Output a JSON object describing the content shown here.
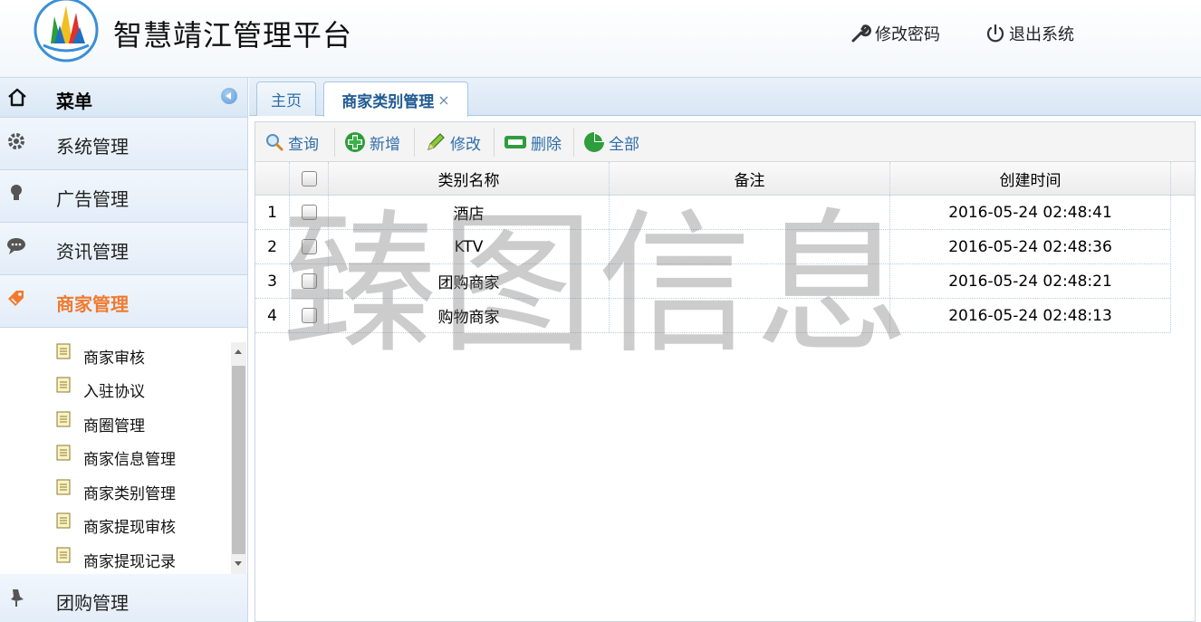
{
  "header": {
    "app_title": "智慧靖江管理平台",
    "change_password": "修改密码",
    "logout": "退出系统"
  },
  "sidebar": {
    "menu_title": "菜单",
    "groups": [
      {
        "label": "系统管理",
        "icon": "gear-icon"
      },
      {
        "label": "广告管理",
        "icon": "lightbulb-icon"
      },
      {
        "label": "资讯管理",
        "icon": "chat-bubble-icon"
      },
      {
        "label": "商家管理",
        "icon": "tag-icon",
        "active": true
      },
      {
        "label": "团购管理",
        "icon": "pin-icon"
      }
    ],
    "sub_items": [
      {
        "label": "商家审核"
      },
      {
        "label": "入驻协议"
      },
      {
        "label": "商圈管理"
      },
      {
        "label": "商家信息管理"
      },
      {
        "label": "商家类别管理"
      },
      {
        "label": "商家提现审核"
      },
      {
        "label": "商家提现记录"
      }
    ]
  },
  "tabs": [
    {
      "label": "主页"
    },
    {
      "label": "商家类别管理",
      "active": true,
      "close": "×"
    }
  ],
  "toolbar": {
    "query": "查询",
    "add": "新增",
    "edit": "修改",
    "delete": "删除",
    "all": "全部"
  },
  "grid": {
    "columns": [
      "类别名称",
      "备注",
      "创建时间"
    ],
    "rows": [
      {
        "num": "1",
        "name": "酒店",
        "remark": "",
        "created": "2016-05-24 02:48:41"
      },
      {
        "num": "2",
        "name": "KTV",
        "remark": "",
        "created": "2016-05-24 02:48:36"
      },
      {
        "num": "3",
        "name": "团购商家",
        "remark": "",
        "created": "2016-05-24 02:48:21"
      },
      {
        "num": "4",
        "name": "购物商家",
        "remark": "",
        "created": "2016-05-24 02:48:13"
      }
    ]
  },
  "watermark": "臻图信息",
  "colors": {
    "accent_orange": "#f07a30",
    "link_blue": "#2f6ea8",
    "border_blue": "#c5d8ea"
  }
}
